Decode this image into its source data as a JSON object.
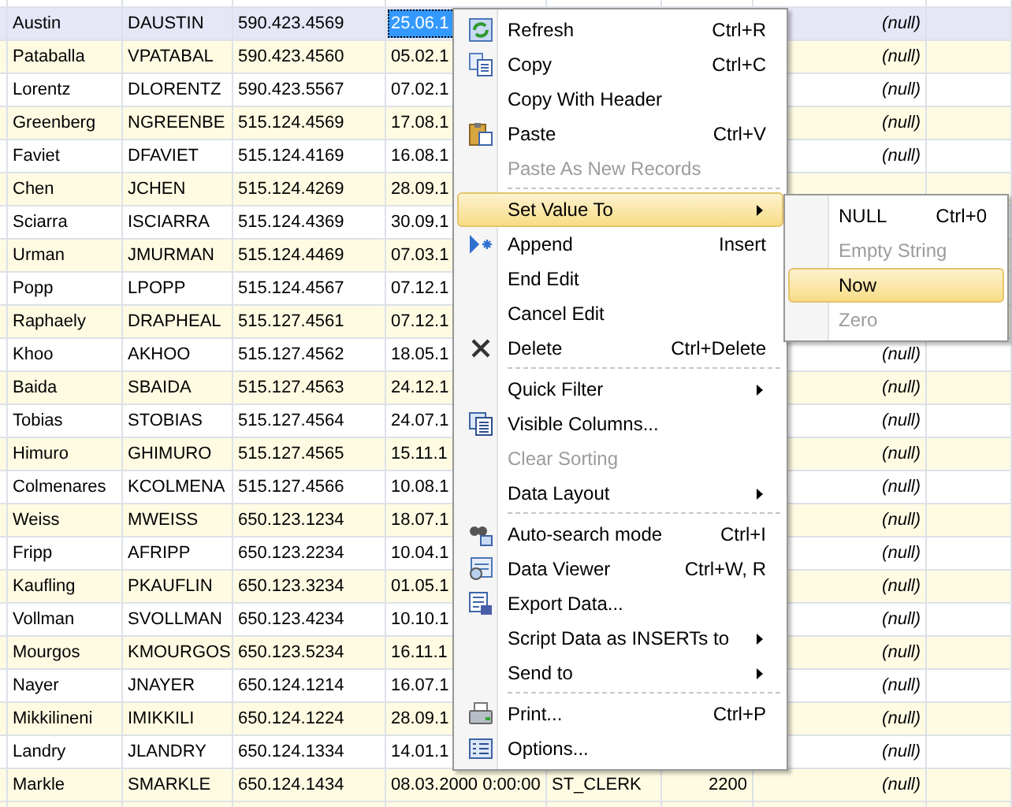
{
  "grid": {
    "rows": [
      {
        "last_name": "Austin",
        "login": "DAUSTIN",
        "phone": "590.423.4569",
        "date": "25.06.1",
        "note": "(null)",
        "selected": true,
        "focused": true
      },
      {
        "last_name": "Pataballa",
        "login": "VPATABAL",
        "phone": "590.423.4560",
        "date": "05.02.1",
        "note": "(null)",
        "selected": false,
        "focused": false
      },
      {
        "last_name": "Lorentz",
        "login": "DLORENTZ",
        "phone": "590.423.5567",
        "date": "07.02.1",
        "note": "(null)",
        "selected": false,
        "focused": false
      },
      {
        "last_name": "Greenberg",
        "login": "NGREENBE",
        "phone": "515.124.4569",
        "date": "17.08.1",
        "note": "(null)",
        "selected": false,
        "focused": false
      },
      {
        "last_name": "Faviet",
        "login": "DFAVIET",
        "phone": "515.124.4169",
        "date": "16.08.1",
        "note": "(null)",
        "selected": false,
        "focused": false
      },
      {
        "last_name": "Chen",
        "login": "JCHEN",
        "phone": "515.124.4269",
        "date": "28.09.1",
        "selected": false,
        "focused": false
      },
      {
        "last_name": "Sciarra",
        "login": "ISCIARRA",
        "phone": "515.124.4369",
        "date": "30.09.1",
        "selected": false,
        "focused": false
      },
      {
        "last_name": "Urman",
        "login": "JMURMAN",
        "phone": "515.124.4469",
        "date": "07.03.1",
        "selected": false,
        "focused": false
      },
      {
        "last_name": "Popp",
        "login": "LPOPP",
        "phone": "515.124.4567",
        "date": "07.12.1",
        "selected": false,
        "focused": false
      },
      {
        "last_name": "Raphaely",
        "login": "DRAPHEAL",
        "phone": "515.127.4561",
        "date": "07.12.1",
        "selected": false,
        "focused": false
      },
      {
        "last_name": "Khoo",
        "login": "AKHOO",
        "phone": "515.127.4562",
        "date": "18.05.1",
        "note": "(null)",
        "selected": false,
        "focused": false
      },
      {
        "last_name": "Baida",
        "login": "SBAIDA",
        "phone": "515.127.4563",
        "date": "24.12.1",
        "note": "(null)",
        "selected": false,
        "focused": false
      },
      {
        "last_name": "Tobias",
        "login": "STOBIAS",
        "phone": "515.127.4564",
        "date": "24.07.1",
        "note": "(null)",
        "selected": false,
        "focused": false
      },
      {
        "last_name": "Himuro",
        "login": "GHIMURO",
        "phone": "515.127.4565",
        "date": "15.11.1",
        "note": "(null)",
        "selected": false,
        "focused": false
      },
      {
        "last_name": "Colmenares",
        "login": "KCOLMENA",
        "phone": "515.127.4566",
        "date": "10.08.1",
        "note": "(null)",
        "selected": false,
        "focused": false
      },
      {
        "last_name": "Weiss",
        "login": "MWEISS",
        "phone": "650.123.1234",
        "date": "18.07.1",
        "note": "(null)",
        "selected": false,
        "focused": false
      },
      {
        "last_name": "Fripp",
        "login": "AFRIPP",
        "phone": "650.123.2234",
        "date": "10.04.1",
        "note": "(null)",
        "selected": false,
        "focused": false
      },
      {
        "last_name": "Kaufling",
        "login": "PKAUFLIN",
        "phone": "650.123.3234",
        "date": "01.05.1",
        "note": "(null)",
        "selected": false,
        "focused": false
      },
      {
        "last_name": "Vollman",
        "login": "SVOLLMAN",
        "phone": "650.123.4234",
        "date": "10.10.1",
        "note": "(null)",
        "selected": false,
        "focused": false
      },
      {
        "last_name": "Mourgos",
        "login": "KMOURGOS",
        "phone": "650.123.5234",
        "date": "16.11.1",
        "note": "(null)",
        "selected": false,
        "focused": false
      },
      {
        "last_name": "Nayer",
        "login": "JNAYER",
        "phone": "650.124.1214",
        "date": "16.07.1",
        "note": "(null)",
        "selected": false,
        "focused": false
      },
      {
        "last_name": "Mikkilineni",
        "login": "IMIKKILI",
        "phone": "650.124.1224",
        "date": "28.09.1",
        "note": "(null)",
        "selected": false,
        "focused": false
      },
      {
        "last_name": "Landry",
        "login": "JLANDRY",
        "phone": "650.124.1334",
        "date": "14.01.1",
        "note": "(null)",
        "selected": false,
        "focused": false
      },
      {
        "last_name": "Markle",
        "login": "SMARKLE",
        "phone": "650.124.1434",
        "date": "08.03.2000 0:00:00",
        "job": "ST_CLERK",
        "salary": "2200",
        "note": "(null)",
        "selected": false,
        "focused": false
      }
    ]
  },
  "context_menu": {
    "items": [
      {
        "kind": "item",
        "label": "Refresh",
        "shortcut": "Ctrl+R",
        "disabled": false,
        "selected": false,
        "submenu": false
      },
      {
        "kind": "item",
        "label": "Copy",
        "shortcut": "Ctrl+C",
        "disabled": false,
        "selected": false,
        "submenu": false
      },
      {
        "kind": "item",
        "label": "Copy With Header",
        "disabled": false,
        "selected": false,
        "submenu": false
      },
      {
        "kind": "item",
        "label": "Paste",
        "shortcut": "Ctrl+V",
        "disabled": false,
        "selected": false,
        "submenu": false
      },
      {
        "kind": "item",
        "label": "Paste As New Records",
        "disabled": true,
        "selected": false,
        "submenu": false
      },
      {
        "kind": "separator"
      },
      {
        "kind": "item",
        "label": "Set Value To",
        "disabled": false,
        "selected": true,
        "submenu": true
      },
      {
        "kind": "item",
        "label": "Append",
        "shortcut": "Insert",
        "disabled": false,
        "selected": false,
        "submenu": false
      },
      {
        "kind": "item",
        "label": "End Edit",
        "disabled": false,
        "selected": false,
        "submenu": false
      },
      {
        "kind": "item",
        "label": "Cancel Edit",
        "disabled": false,
        "selected": false,
        "submenu": false
      },
      {
        "kind": "item",
        "label": "Delete",
        "shortcut": "Ctrl+Delete",
        "disabled": false,
        "selected": false,
        "submenu": false
      },
      {
        "kind": "separator"
      },
      {
        "kind": "item",
        "label": "Quick Filter",
        "disabled": false,
        "selected": false,
        "submenu": true
      },
      {
        "kind": "item",
        "label": "Visible Columns...",
        "disabled": false,
        "selected": false,
        "submenu": false
      },
      {
        "kind": "item",
        "label": "Clear Sorting",
        "disabled": true,
        "selected": false,
        "submenu": false
      },
      {
        "kind": "item",
        "label": "Data Layout",
        "disabled": false,
        "selected": false,
        "submenu": true
      },
      {
        "kind": "separator"
      },
      {
        "kind": "item",
        "label": "Auto-search mode",
        "shortcut": "Ctrl+I",
        "disabled": false,
        "selected": false,
        "submenu": false
      },
      {
        "kind": "item",
        "label": "Data Viewer",
        "shortcut": "Ctrl+W, R",
        "disabled": false,
        "selected": false,
        "submenu": false
      },
      {
        "kind": "item",
        "label": "Export Data...",
        "disabled": false,
        "selected": false,
        "submenu": false
      },
      {
        "kind": "item",
        "label": "Script Data as INSERTs to",
        "disabled": false,
        "selected": false,
        "submenu": true
      },
      {
        "kind": "item",
        "label": "Send to",
        "disabled": false,
        "selected": false,
        "submenu": true
      },
      {
        "kind": "separator"
      },
      {
        "kind": "item",
        "label": "Print...",
        "shortcut": "Ctrl+P",
        "disabled": false,
        "selected": false,
        "submenu": false
      },
      {
        "kind": "item",
        "label": "Options...",
        "disabled": false,
        "selected": false,
        "submenu": false
      }
    ]
  },
  "submenu": {
    "items": [
      {
        "label": "NULL",
        "shortcut": "Ctrl+0",
        "disabled": false,
        "selected": false
      },
      {
        "label": "Empty String",
        "disabled": true,
        "selected": false
      },
      {
        "label": "Now",
        "disabled": false,
        "selected": true
      },
      {
        "label": "Zero",
        "disabled": true,
        "selected": false
      }
    ]
  }
}
